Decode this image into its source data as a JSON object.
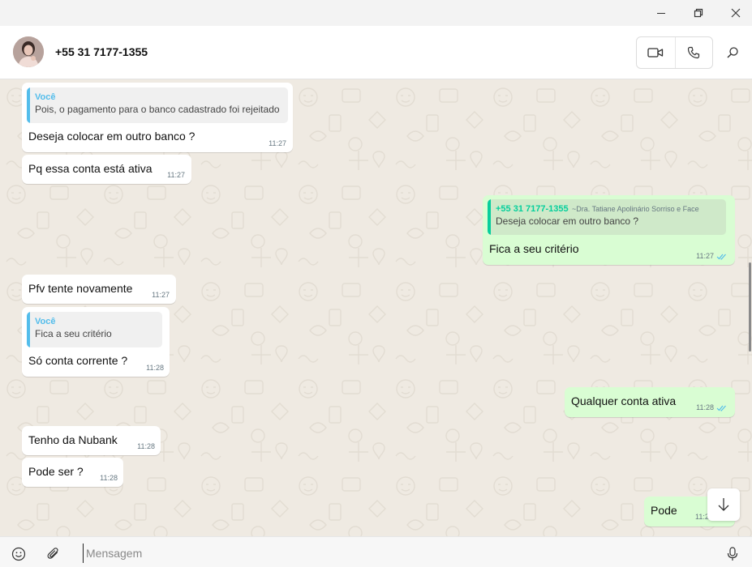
{
  "window": {
    "controls": [
      "minimize-icon",
      "restore-icon",
      "close-icon"
    ]
  },
  "header": {
    "contact_name": "+55 31 7177-1355",
    "icons": [
      "video-call-icon",
      "voice-call-icon",
      "search-icon"
    ]
  },
  "messages": [
    {
      "dir": "in",
      "quote": {
        "author": "Você",
        "text": "Pois, o pagamento para o banco cadastrado foi rejeitado"
      },
      "text": "Deseja colocar em outro banco ?",
      "time": "11:27"
    },
    {
      "dir": "in",
      "text": "Pq essa conta está ativa",
      "time": "11:27"
    },
    {
      "dir": "out",
      "quote": {
        "author": "+55 31 7177-1355",
        "sub": "~Dra. Tatiane Apolinário  Sorriso e Face",
        "text": "Deseja colocar em outro banco ?"
      },
      "text": "Fica a seu critério",
      "time": "11:27",
      "read": true
    },
    {
      "dir": "in",
      "text": "Pfv tente novamente",
      "time": "11:27"
    },
    {
      "dir": "in",
      "quote": {
        "author": "Você",
        "text": "Fica a seu critério"
      },
      "text": "Só conta corrente ?",
      "time": "11:28"
    },
    {
      "dir": "out",
      "text": "Qualquer conta ativa",
      "time": "11:28",
      "read": true
    },
    {
      "dir": "in",
      "text": "Tenho da Nubank",
      "time": "11:28"
    },
    {
      "dir": "in",
      "text": "Pode ser ?",
      "time": "11:28"
    },
    {
      "dir": "out",
      "text": "Pode",
      "time": "11:2"
    }
  ],
  "composer": {
    "placeholder": "Mensagem",
    "icons": [
      "emoji-icon",
      "attach-icon",
      "mic-icon"
    ]
  },
  "colors": {
    "chat_background": "#efeae2",
    "incoming_bubble": "#ffffff",
    "outgoing_bubble": "#d9fdd3",
    "quote_blue": "#53bdeb",
    "quote_green": "#06cf9c",
    "read_ticks": "#53bdeb"
  }
}
